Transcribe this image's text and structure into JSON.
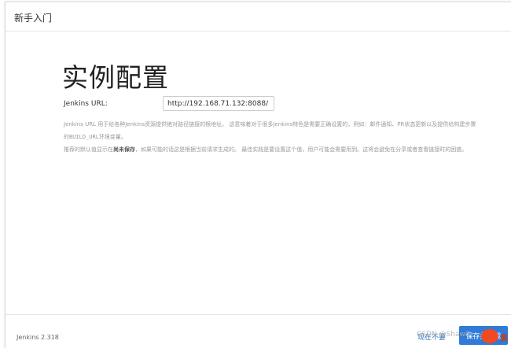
{
  "header": {
    "title": "新手入门"
  },
  "main": {
    "title": "实例配置",
    "url_label": "Jenkins URL:",
    "url_value": "http://192.168.71.132:8088/",
    "help_1_a": "Jenkins URL 用于给各种Jenkins资源提供绝对路径链接的根地址。 这意味着对于很多Jenkins特色是需要正确设置的，例如：邮件通知、PR状态更新以及提供给构建步骤的",
    "help_1_code": "BUILD_URL",
    "help_1_b": "环境变量。",
    "help_2_a": "推荐的默认值显示在",
    "help_2_bold": "尚未保存",
    "help_2_b": "，如果可能的话这是根据当前请求生成的。 最佳实践是要设置这个值，用户可能会需要用到。这将会避免在分享或者查看链接时的困惑。"
  },
  "footer": {
    "version": "Jenkins 2.318",
    "skip_label": "现在不要",
    "save_label": "保存并完成"
  },
  "watermark": {
    "text": "CSDN @ShawC",
    "badge": "英"
  }
}
